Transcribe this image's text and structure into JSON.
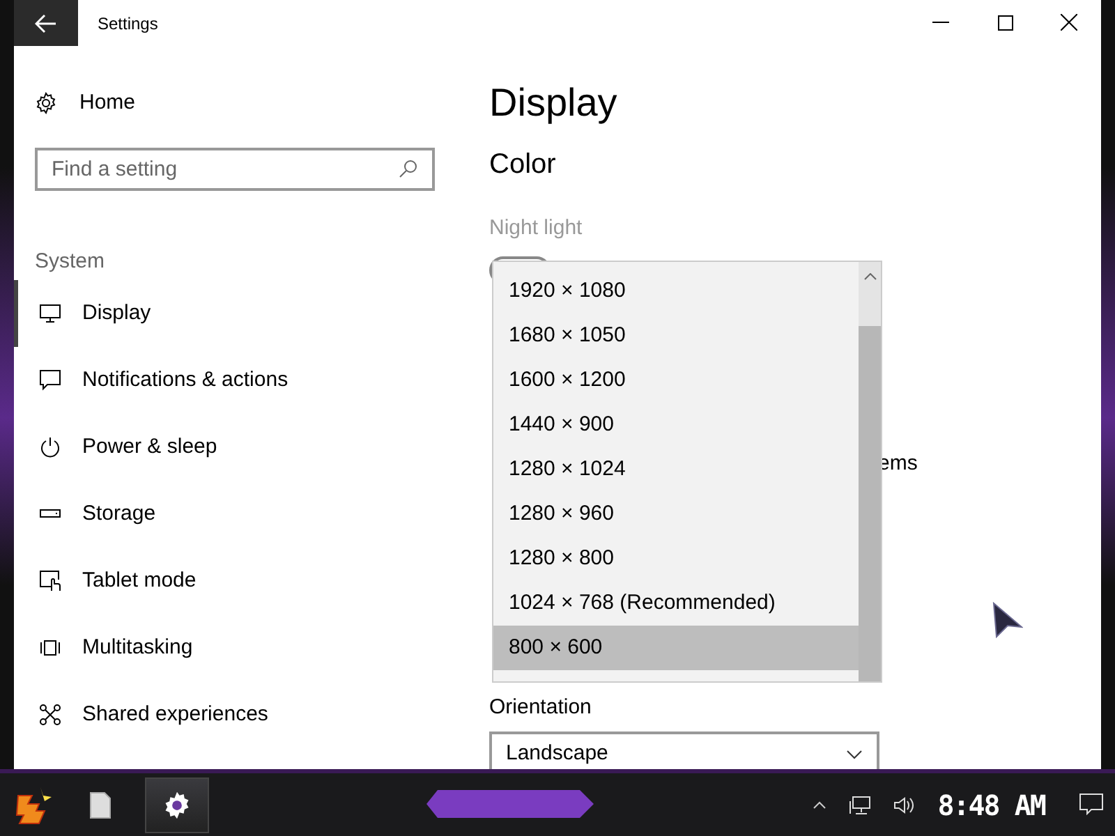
{
  "window": {
    "title": "Settings"
  },
  "sidebar": {
    "home": "Home",
    "search": {
      "placeholder": "Find a setting"
    },
    "section": "System",
    "items": [
      {
        "label": "Display",
        "selected": true
      },
      {
        "label": "Notifications & actions",
        "selected": false
      },
      {
        "label": "Power & sleep",
        "selected": false
      },
      {
        "label": "Storage",
        "selected": false
      },
      {
        "label": "Tablet mode",
        "selected": false
      },
      {
        "label": "Multitasking",
        "selected": false
      },
      {
        "label": "Shared experiences",
        "selected": false
      }
    ]
  },
  "content": {
    "title": "Display",
    "section": "Color",
    "night_light": {
      "label": "Night light",
      "on": false
    },
    "partial_text": "ems",
    "resolution_list": {
      "items": [
        {
          "label": "1920 × 1080",
          "selected": false
        },
        {
          "label": "1680 × 1050",
          "selected": false
        },
        {
          "label": "1600 × 1200",
          "selected": false
        },
        {
          "label": "1440 × 900",
          "selected": false
        },
        {
          "label": "1280 × 1024",
          "selected": false
        },
        {
          "label": "1280 × 960",
          "selected": false
        },
        {
          "label": "1280 × 800",
          "selected": false
        },
        {
          "label": "1024 × 768 (Recommended)",
          "selected": false
        },
        {
          "label": "800 × 600",
          "selected": true
        }
      ]
    },
    "orientation": {
      "label": "Orientation",
      "value": "Landscape"
    }
  },
  "taskbar": {
    "apps": [
      {
        "kind": "logo",
        "active": false
      },
      {
        "kind": "file",
        "active": false
      },
      {
        "kind": "settings",
        "active": true
      }
    ],
    "clock": "8:48 AM"
  }
}
